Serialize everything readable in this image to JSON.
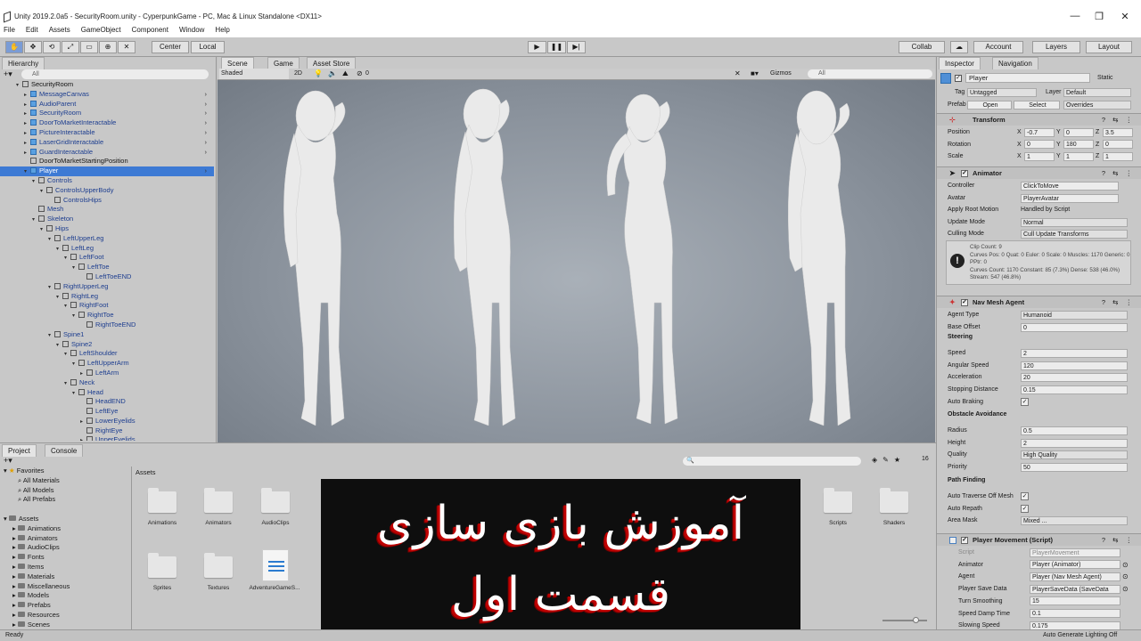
{
  "window": {
    "title": "Unity 2019.2.0a5 - SecurityRoom.unity - CyperpunkGame - PC, Mac & Linux Standalone <DX11>",
    "controls": [
      "—",
      "❐",
      "✕"
    ]
  },
  "menu": [
    "File",
    "Edit",
    "Assets",
    "GameObject",
    "Component",
    "Window",
    "Help"
  ],
  "toolbar": {
    "pivot": "Center",
    "space": "Local",
    "collab": "Collab",
    "account": "Account",
    "layers": "Layers",
    "layout": "Layout"
  },
  "hierarchy": {
    "tab": "Hierarchy",
    "search_placeholder": "All",
    "items": [
      {
        "label": "SecurityRoom",
        "depth": 0,
        "kind": "root",
        "arrow": "▾"
      },
      {
        "label": "MessageCanvas",
        "depth": 1,
        "kind": "prefab",
        "arrow": "▸",
        "more": true
      },
      {
        "label": "AudioParent",
        "depth": 1,
        "kind": "prefab",
        "arrow": "▸",
        "more": true
      },
      {
        "label": "SecurityRoom",
        "depth": 1,
        "kind": "prefab",
        "arrow": "▸",
        "more": true
      },
      {
        "label": "DoorToMarketInteractable",
        "depth": 1,
        "kind": "prefab",
        "arrow": "▸",
        "more": true
      },
      {
        "label": "PictureInteractable",
        "depth": 1,
        "kind": "prefab",
        "arrow": "▸",
        "more": true
      },
      {
        "label": "LaserGridInteractable",
        "depth": 1,
        "kind": "prefab",
        "arrow": "▸",
        "more": true
      },
      {
        "label": "GuardInteractable",
        "depth": 1,
        "kind": "prefab",
        "arrow": "▸",
        "more": true
      },
      {
        "label": "DoorToMarketStartingPosition",
        "depth": 1,
        "kind": "plain",
        "arrow": ""
      },
      {
        "label": "Player",
        "depth": 1,
        "kind": "selected",
        "arrow": "▾",
        "more": true
      },
      {
        "label": "Controls",
        "depth": 2,
        "kind": "child",
        "arrow": "▾"
      },
      {
        "label": "ControlsUpperBody",
        "depth": 3,
        "kind": "child",
        "arrow": "▾"
      },
      {
        "label": "ControlsHips",
        "depth": 4,
        "kind": "child",
        "arrow": ""
      },
      {
        "label": "Mesh",
        "depth": 2,
        "kind": "child",
        "arrow": ""
      },
      {
        "label": "Skeleton",
        "depth": 2,
        "kind": "child",
        "arrow": "▾"
      },
      {
        "label": "Hips",
        "depth": 3,
        "kind": "child",
        "arrow": "▾"
      },
      {
        "label": "LeftUpperLeg",
        "depth": 4,
        "kind": "child",
        "arrow": "▾"
      },
      {
        "label": "LeftLeg",
        "depth": 5,
        "kind": "child",
        "arrow": "▾"
      },
      {
        "label": "LeftFoot",
        "depth": 6,
        "kind": "child",
        "arrow": "▾"
      },
      {
        "label": "LeftToe",
        "depth": 7,
        "kind": "child",
        "arrow": "▾"
      },
      {
        "label": "LeftToeEND",
        "depth": 8,
        "kind": "child",
        "arrow": ""
      },
      {
        "label": "RightUpperLeg",
        "depth": 4,
        "kind": "child",
        "arrow": "▾"
      },
      {
        "label": "RightLeg",
        "depth": 5,
        "kind": "child",
        "arrow": "▾"
      },
      {
        "label": "RightFoot",
        "depth": 6,
        "kind": "child",
        "arrow": "▾"
      },
      {
        "label": "RightToe",
        "depth": 7,
        "kind": "child",
        "arrow": "▾"
      },
      {
        "label": "RightToeEND",
        "depth": 8,
        "kind": "child",
        "arrow": ""
      },
      {
        "label": "Spine1",
        "depth": 4,
        "kind": "child",
        "arrow": "▾"
      },
      {
        "label": "Spine2",
        "depth": 5,
        "kind": "child",
        "arrow": "▾"
      },
      {
        "label": "LeftShoulder",
        "depth": 6,
        "kind": "child",
        "arrow": "▾"
      },
      {
        "label": "LeftUpperArm",
        "depth": 7,
        "kind": "child",
        "arrow": "▾"
      },
      {
        "label": "LeftArm",
        "depth": 8,
        "kind": "child",
        "arrow": "▸"
      },
      {
        "label": "Neck",
        "depth": 6,
        "kind": "child",
        "arrow": "▾"
      },
      {
        "label": "Head",
        "depth": 7,
        "kind": "child",
        "arrow": "▾"
      },
      {
        "label": "HeadEND",
        "depth": 8,
        "kind": "child",
        "arrow": ""
      },
      {
        "label": "LeftEye",
        "depth": 8,
        "kind": "child",
        "arrow": ""
      },
      {
        "label": "LowerEyelids",
        "depth": 8,
        "kind": "child",
        "arrow": "▸"
      },
      {
        "label": "RightEye",
        "depth": 8,
        "kind": "child",
        "arrow": ""
      },
      {
        "label": "UpperEyelids",
        "depth": 8,
        "kind": "child",
        "arrow": "▸"
      }
    ]
  },
  "scene": {
    "tabs": [
      "Scene",
      "Game",
      "Asset Store"
    ],
    "draw_mode": "Shaded",
    "mode_2d": "2D",
    "fx_count": "0",
    "gizmos": "Gizmos",
    "search_placeholder": "All"
  },
  "inspector": {
    "tabs": [
      "Inspector",
      "Navigation"
    ],
    "object_name": "Player",
    "static_label": "Static",
    "tag_label": "Tag",
    "tag_value": "Untagged",
    "layer_label": "Layer",
    "layer_value": "Default",
    "prefab_label": "Prefab",
    "prefab_open": "Open",
    "prefab_select": "Select",
    "prefab_overrides": "Overrides",
    "transform": {
      "title": "Transform",
      "position_label": "Position",
      "position": [
        "-0.7",
        "0",
        "3.5"
      ],
      "rotation_label": "Rotation",
      "rotation": [
        "0",
        "180",
        "0"
      ],
      "scale_label": "Scale",
      "scale": [
        "1",
        "1",
        "1"
      ],
      "axes": [
        "X",
        "Y",
        "Z"
      ]
    },
    "animator": {
      "title": "Animator",
      "controller_label": "Controller",
      "controller": "ClickToMove",
      "avatar_label": "Avatar",
      "avatar": "PlayerAvatar",
      "root_motion_label": "Apply Root Motion",
      "root_motion": "Handled by Script",
      "update_mode_label": "Update Mode",
      "update_mode": "Normal",
      "culling_label": "Culling Mode",
      "culling": "Cull Update Transforms",
      "info": "Clip Count: 9\nCurves Pos: 0 Quat: 0 Euler: 0 Scale: 0 Muscles: 1170 Generic: 0 PPtr: 0\nCurves Count: 1170 Constant: 85 (7.3%) Dense: 538 (46.0%) Stream: 547 (46.8%)"
    },
    "navmesh": {
      "title": "Nav Mesh Agent",
      "agent_type_label": "Agent Type",
      "agent_type": "Humanoid",
      "base_offset_label": "Base Offset",
      "base_offset": "0",
      "steering": "Steering",
      "speed_label": "Speed",
      "speed": "2",
      "angular_label": "Angular Speed",
      "angular": "120",
      "accel_label": "Acceleration",
      "accel": "20",
      "stopping_label": "Stopping Distance",
      "stopping": "0.15",
      "braking_label": "Auto Braking",
      "obstacle": "Obstacle Avoidance",
      "radius_label": "Radius",
      "radius": "0.5",
      "height_label": "Height",
      "height": "2",
      "quality_label": "Quality",
      "quality": "High Quality",
      "priority_label": "Priority",
      "priority": "50",
      "pathfinding": "Path Finding",
      "traverse_label": "Auto Traverse Off Mesh",
      "repath_label": "Auto Repath",
      "area_label": "Area Mask",
      "area": "Mixed ..."
    },
    "playermove": {
      "title": "Player Movement (Script)",
      "script_label": "Script",
      "script": "PlayerMovement",
      "animator_label": "Animator",
      "animator": "Player (Animator)",
      "agent_label": "Agent",
      "agent": "Player (Nav Mesh Agent)",
      "savedata_label": "Player Save Data",
      "savedata": "PlayerSaveData (SaveData",
      "turn_label": "Turn Smoothing",
      "turn": "15",
      "damp_label": "Speed Damp Time",
      "damp": "0.1",
      "slowing_label": "Slowing Speed",
      "slowing": "0.175"
    }
  },
  "project": {
    "tabs": [
      "Project",
      "Console"
    ],
    "favorites_label": "Favorites",
    "favorites": [
      "All Materials",
      "All Models",
      "All Prefabs"
    ],
    "assets_label": "Assets",
    "folders": [
      "Animations",
      "Animators",
      "AudioClips",
      "Fonts",
      "Items",
      "Materials",
      "Miscellaneous",
      "Models",
      "Prefabs",
      "Resources",
      "Scenes"
    ],
    "breadcrumb": "Assets",
    "tiles_row1": [
      "Animations",
      "Animators",
      "AudioClips",
      "Scripts",
      "Shaders"
    ],
    "tiles_row2": [
      "Sprites",
      "Textures",
      "AdventureGameS..."
    ],
    "hidden_count": "16"
  },
  "overlay": {
    "line1": "آموزش بازی سازی",
    "line2": "قسمت اول"
  },
  "status": {
    "left": "Ready",
    "right": "Auto Generate Lighting Off"
  }
}
